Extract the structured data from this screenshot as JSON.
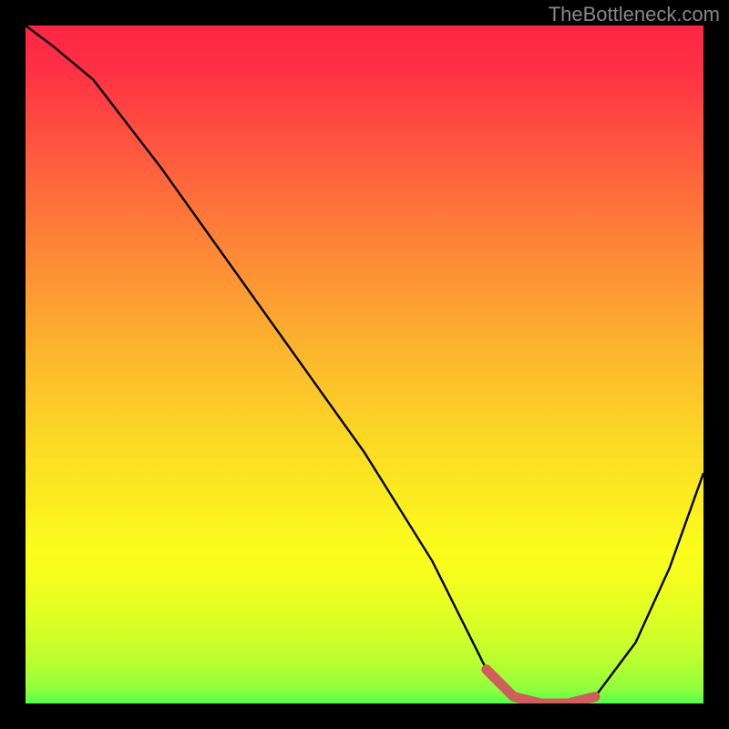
{
  "watermark": "TheBottleneck.com",
  "chart_data": {
    "type": "line",
    "title": "",
    "xlabel": "",
    "ylabel": "",
    "xlim": [
      0,
      100
    ],
    "ylim": [
      0,
      100
    ],
    "series": [
      {
        "name": "bottleneck-curve",
        "x": [
          0,
          4,
          10,
          20,
          30,
          40,
          50,
          60,
          65,
          68,
          72,
          76,
          80,
          84,
          90,
          95,
          100
        ],
        "y": [
          100,
          97,
          92,
          79,
          65,
          51,
          37,
          21,
          11,
          5,
          1,
          0,
          0,
          1,
          9,
          20,
          34
        ]
      }
    ],
    "highlight": {
      "name": "optimal-region",
      "x": [
        68,
        72,
        76,
        80,
        84
      ],
      "y": [
        5,
        1,
        0,
        0,
        1
      ]
    },
    "colors": {
      "curve": "#000000",
      "highlight": "#ce5f5c",
      "gradient_top": "#fe2544",
      "gradient_bottom": "#55fd4f",
      "frame": "#000000"
    }
  }
}
